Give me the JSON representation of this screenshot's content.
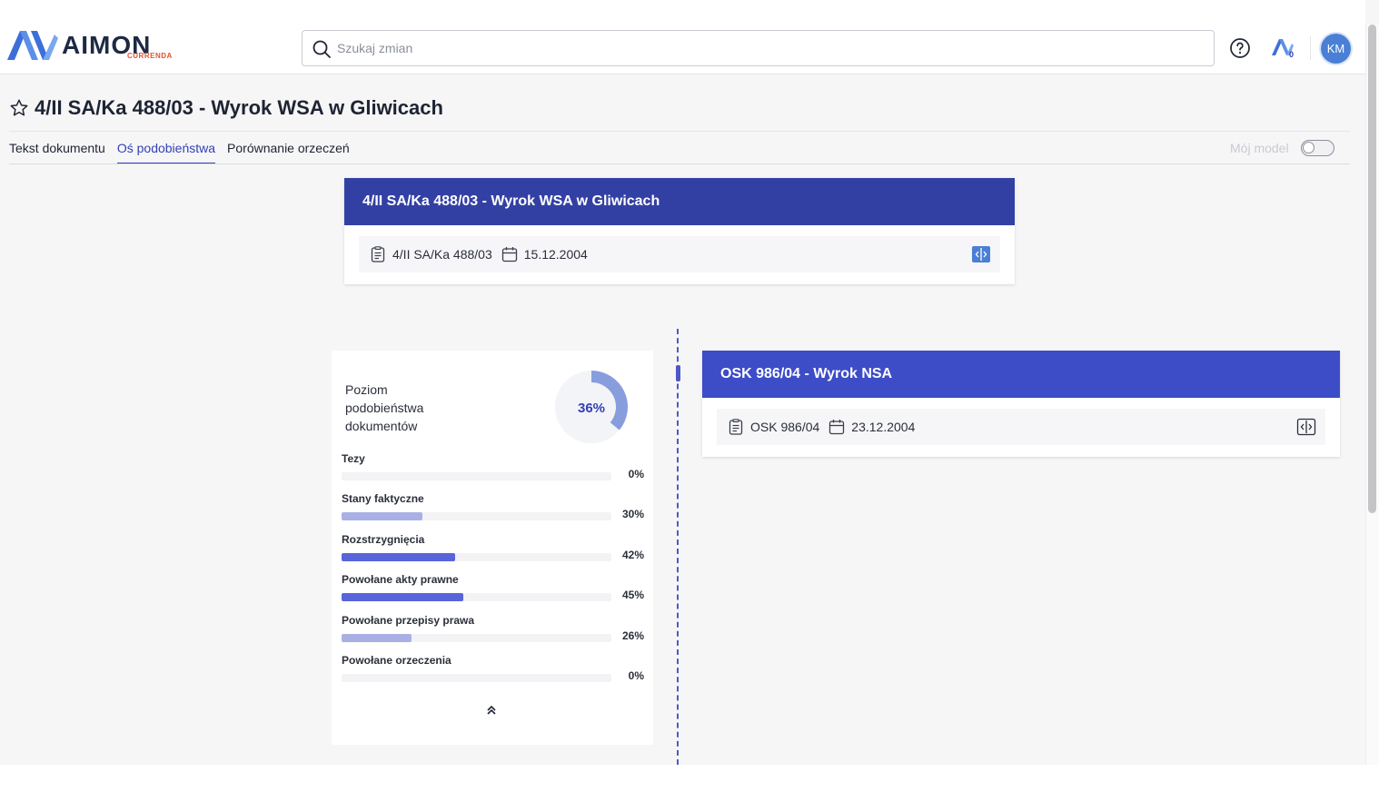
{
  "header": {
    "brand": "AIMON",
    "brand_sub": "CURRENDA",
    "search_placeholder": "Szukaj zmian",
    "notifications_count": "0",
    "user_initials": "KM"
  },
  "page": {
    "title": "4/II SA/Ka 488/03 - Wyrok WSA w Gliwicach",
    "tabs": [
      {
        "label": "Tekst dokumentu",
        "active": false
      },
      {
        "label": "Oś podobieństwa",
        "active": true
      },
      {
        "label": "Porównanie orzeczeń",
        "active": false
      }
    ],
    "my_model_label": "Mój model",
    "my_model_enabled": false
  },
  "source_card": {
    "title": "4/II SA/Ka 488/03 - Wyrok WSA w Gliwicach",
    "signature": "4/II SA/Ka 488/03",
    "date": "15.12.2004",
    "header_color": "#3340a3"
  },
  "similar_card": {
    "title": "OSK 986/04 - Wyrok NSA",
    "signature": "OSK 986/04",
    "date": "23.12.2004",
    "header_color": "#3d4cc7"
  },
  "similarity": {
    "title": "Poziom podobieństwa dokumentów",
    "overall_percent": 36,
    "overall_label": "36%",
    "metrics": [
      {
        "label": "Tezy",
        "value": 0,
        "value_label": "0%"
      },
      {
        "label": "Stany faktyczne",
        "value": 30,
        "value_label": "30%"
      },
      {
        "label": "Rozstrzygnięcia",
        "value": 42,
        "value_label": "42%"
      },
      {
        "label": "Powołane akty prawne",
        "value": 45,
        "value_label": "45%"
      },
      {
        "label": "Powołane przepisy prawa",
        "value": 26,
        "value_label": "26%"
      },
      {
        "label": "Powołane orzeczenia",
        "value": 0,
        "value_label": "0%"
      }
    ],
    "colors": {
      "high": "#5864da",
      "low": "#a9b0e6",
      "donut": "#7c93d8"
    }
  }
}
